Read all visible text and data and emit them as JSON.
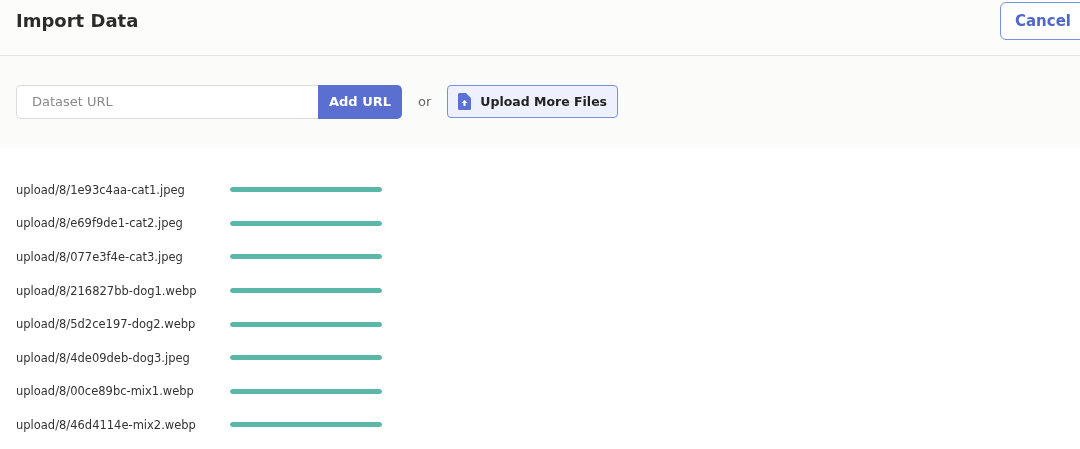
{
  "header": {
    "title": "Import Data",
    "cancel_button": "Cancel"
  },
  "toolbar": {
    "url_field": {
      "placeholder": "Dataset URL"
    },
    "add_button": "Add URL",
    "separator": "or",
    "upload_button": "Upload More Files"
  },
  "files": [
    {
      "name": "upload/8/1e93c4aa-cat1.jpeg",
      "level": 1
    },
    {
      "name": "upload/8/e69f9de1-cat2.jpeg",
      "level": 1
    },
    {
      "name": "upload/8/077e3f4e-cat3.jpeg",
      "level": 1
    },
    {
      "name": "upload/8/216827bb-dog1.webp",
      "level": 1
    },
    {
      "name": "upload/8/5d2ce197-dog2.webp",
      "level": 1
    },
    {
      "name": "upload/8/4de09deb-dog3.jpeg",
      "level": 1
    },
    {
      "name": "upload/8/00ce89bc-mix1.webp",
      "level": 1
    },
    {
      "name": "upload/8/46d4114e-mix2.webp",
      "level": 1
    }
  ]
}
